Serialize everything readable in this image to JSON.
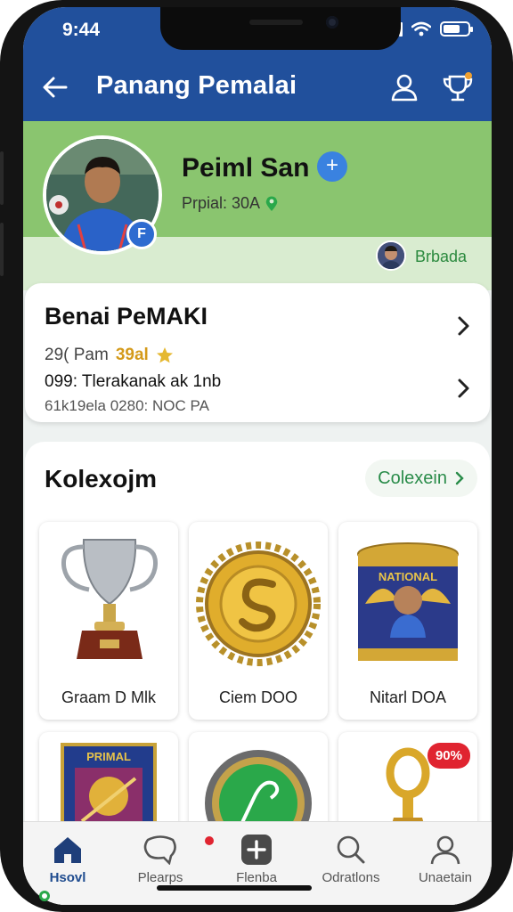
{
  "status": {
    "time": "9:44"
  },
  "header": {
    "title": "Panang Pemalai",
    "back_icon": "arrow-left-icon",
    "icons": [
      "person-icon",
      "trophy-icon"
    ],
    "accent": "#21509c"
  },
  "profile": {
    "name": "Peiml San",
    "subtitle": "Prpial: 30A",
    "badge": "F",
    "follower_label": "Brbada"
  },
  "info": {
    "title": "Benai PeMAKI",
    "rating_prefix": "29( Pam",
    "rating_value": "39al",
    "line3": "099: Tlerakanak ak 1nb",
    "line4": "61k19ela 0280: NOC PA"
  },
  "collection": {
    "title": "Kolexojm",
    "link_label": "Colexein",
    "items": [
      {
        "label": "Graam D Mlk",
        "icon": "trophy-cup-icon"
      },
      {
        "label": "Ciem DOO",
        "icon": "gold-medal-icon"
      },
      {
        "label": "Nitarl DOA",
        "icon": "card-tin-icon"
      },
      {
        "label": "",
        "icon": "shield-card-icon"
      },
      {
        "label": "",
        "icon": "green-badge-icon"
      },
      {
        "label": "",
        "icon": "gold-trophy-icon",
        "badge": "90%"
      }
    ]
  },
  "tabs": [
    {
      "label": "Hsovl",
      "icon": "home-icon",
      "active": true
    },
    {
      "label": "Plearps",
      "icon": "chat-icon",
      "active": false
    },
    {
      "label": "Flenba",
      "icon": "plus-box-icon",
      "active": false
    },
    {
      "label": "Odratlons",
      "icon": "search-icon",
      "active": false
    },
    {
      "label": "Unaetain",
      "icon": "profile-icon",
      "active": false
    }
  ]
}
